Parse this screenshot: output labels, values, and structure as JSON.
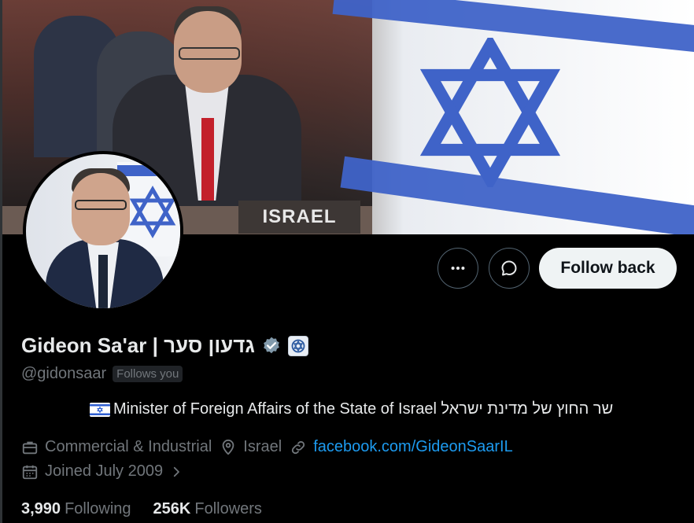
{
  "banner": {
    "nameplate_text": "ISRAEL"
  },
  "actions": {
    "more_icon": "more-horizontal-icon",
    "message_icon": "message-bubble-icon",
    "follow_label": "Follow back"
  },
  "profile": {
    "name": "Gideon Sa'ar | גדעון סער",
    "verified_icon": "verified-badge-icon",
    "affiliation_icon": "affiliation-emblem-icon",
    "handle": "@gidonsaar",
    "follows_you": "Follows you",
    "bio_flag": "israel-flag-icon",
    "bio": "Minister of Foreign Affairs of the State of Israel שר החוץ של מדינת ישראל",
    "category": "Commercial & Industrial",
    "location": "Israel",
    "website": "facebook.com/GideonSaarIL",
    "joined": "Joined July 2009"
  },
  "stats": {
    "following_count": "3,990",
    "following_label": "Following",
    "followers_count": "256K",
    "followers_label": "Followers"
  },
  "colors": {
    "background": "#000000",
    "text_primary": "#e7e9ea",
    "text_secondary": "#71767b",
    "link": "#1d9bf0",
    "follow_button_bg": "#eff3f4",
    "verified_badge": "#829aab"
  }
}
